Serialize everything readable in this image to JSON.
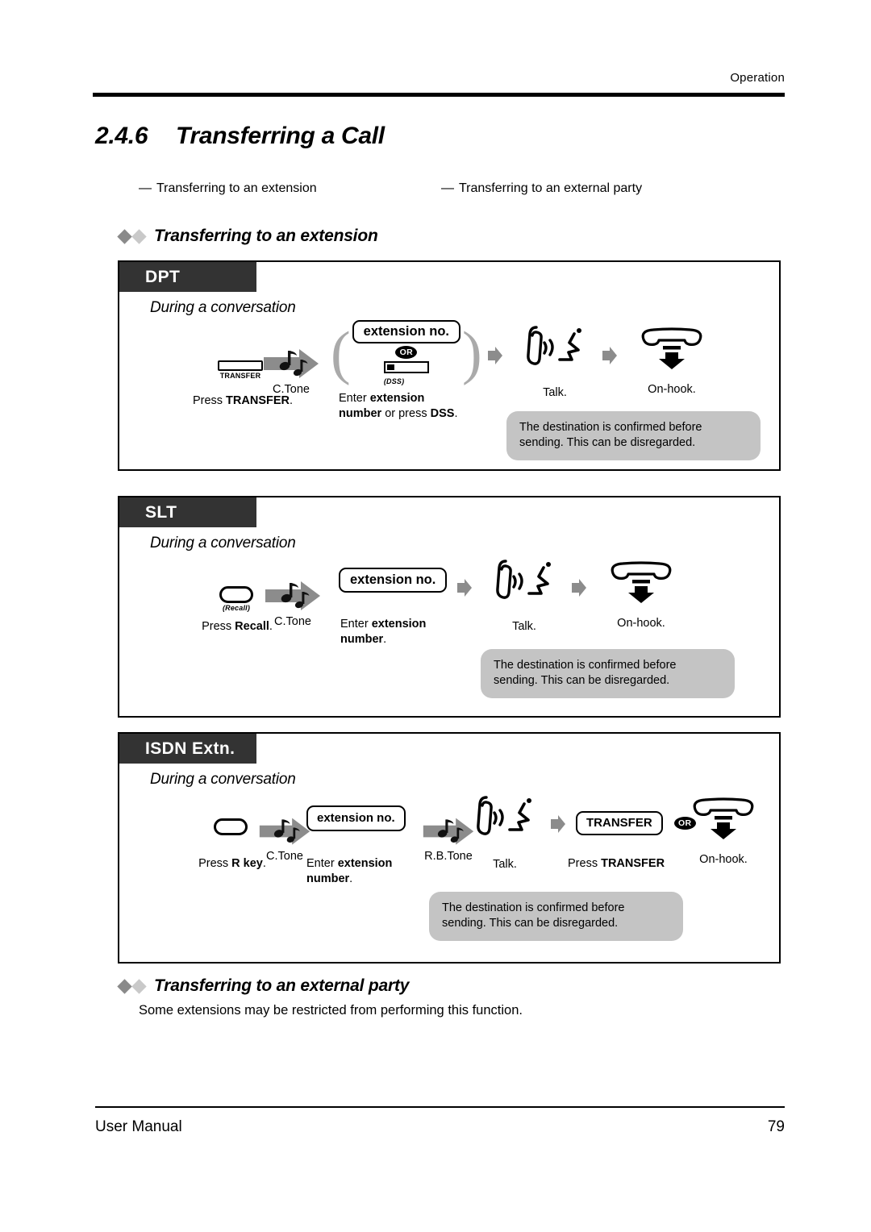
{
  "header": {
    "running_head": "Operation"
  },
  "title": {
    "number": "2.4.6",
    "text": "Transferring a Call"
  },
  "sub_links": [
    {
      "dash": "—",
      "label": "Transferring to an extension"
    },
    {
      "dash": "—",
      "label": "Transferring to an external party"
    }
  ],
  "section_extension": {
    "heading": "Transferring to an extension",
    "panels": [
      {
        "tab": "DPT",
        "subtitle": "During a conversation",
        "steps": [
          {
            "icon": "transfer-key-icon",
            "key_label": "TRANSFER",
            "tone": "",
            "caption_parts": [
              {
                "text": "Press ",
                "bold": false
              },
              {
                "text": "TRANSFER",
                "bold": true
              },
              {
                "text": ".",
                "bold": false
              }
            ]
          },
          {
            "icon": "c-tone-arrow-icon",
            "tone": "C.Tone"
          },
          {
            "icon": "extension-no-pill-group",
            "pill": "extension no.",
            "or": "OR",
            "dss_label": "(DSS)",
            "caption_parts": [
              {
                "text": "Enter ",
                "bold": false
              },
              {
                "text": "extension",
                "bold": true
              },
              {
                "text": "\n",
                "bold": false
              },
              {
                "text": "number",
                "bold": true
              },
              {
                "text": " or press ",
                "bold": false
              },
              {
                "text": "DSS",
                "bold": true
              },
              {
                "text": ".",
                "bold": false
              }
            ]
          },
          {
            "icon": "talk-icon",
            "caption": "Talk."
          },
          {
            "icon": "on-hook-icon",
            "caption": "On-hook."
          }
        ],
        "bubble": "The destination is confirmed before sending. This can be disregarded."
      },
      {
        "tab": "SLT",
        "subtitle": "During a conversation",
        "steps": [
          {
            "icon": "recall-key-icon",
            "key_label": "(Recall)",
            "caption_parts": [
              {
                "text": "Press ",
                "bold": false
              },
              {
                "text": "Recall",
                "bold": true
              },
              {
                "text": ".",
                "bold": false
              }
            ]
          },
          {
            "icon": "c-tone-arrow-icon",
            "tone": "C.Tone"
          },
          {
            "icon": "extension-no-pill",
            "pill": "extension no.",
            "caption_parts": [
              {
                "text": "Enter ",
                "bold": false
              },
              {
                "text": "extension",
                "bold": true
              },
              {
                "text": "\n",
                "bold": false
              },
              {
                "text": "number",
                "bold": true
              },
              {
                "text": ".",
                "bold": false
              }
            ]
          },
          {
            "icon": "talk-icon",
            "caption": "Talk."
          },
          {
            "icon": "on-hook-icon",
            "caption": "On-hook."
          }
        ],
        "bubble": "The destination is confirmed before sending. This can be disregarded."
      },
      {
        "tab": "ISDN Extn.",
        "subtitle": "During a conversation",
        "steps": [
          {
            "icon": "r-key-icon",
            "caption_parts": [
              {
                "text": "Press ",
                "bold": false
              },
              {
                "text": "R key",
                "bold": true
              },
              {
                "text": ".",
                "bold": false
              }
            ]
          },
          {
            "icon": "c-tone-arrow-icon",
            "tone": "C.Tone"
          },
          {
            "icon": "extension-no-pill",
            "pill": "extension no.",
            "caption_parts": [
              {
                "text": "Enter ",
                "bold": false
              },
              {
                "text": "extension",
                "bold": true
              },
              {
                "text": "\n",
                "bold": false
              },
              {
                "text": "number",
                "bold": true
              },
              {
                "text": ".",
                "bold": false
              }
            ]
          },
          {
            "icon": "rb-tone-arrow-icon",
            "tone": "R.B.Tone"
          },
          {
            "icon": "talk-icon",
            "caption": "Talk."
          },
          {
            "icon": "transfer-pill-icon",
            "pill": "TRANSFER",
            "or": "OR",
            "caption_parts": [
              {
                "text": "Press ",
                "bold": false
              },
              {
                "text": "TRANSFER",
                "bold": true
              }
            ]
          },
          {
            "icon": "on-hook-icon",
            "caption": "On-hook."
          }
        ],
        "bubble": "The destination is confirmed before sending. This can be disregarded."
      }
    ]
  },
  "section_external": {
    "heading": "Transferring to an external party",
    "note": "Some extensions may be restricted from performing this function."
  },
  "footer": {
    "left": "User Manual",
    "page": "79"
  },
  "colors": {
    "tab_bg": "#333333",
    "bubble_bg": "#c4c4c4",
    "arrow_grey": "#8c8c8c",
    "diamond_dark": "#8a8a8a",
    "diamond_light": "#c9c9c9"
  }
}
